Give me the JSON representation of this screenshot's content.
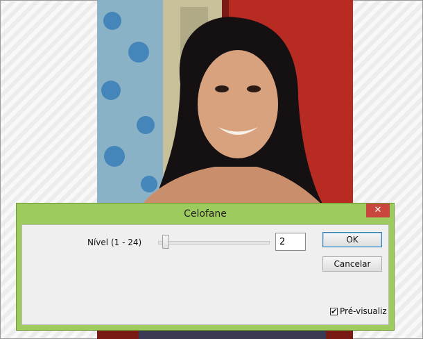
{
  "dialog": {
    "title": "Celofane",
    "close_glyph": "✕",
    "level": {
      "label": "Nível (1 - 24)",
      "value": "2",
      "min": 1,
      "max": 24,
      "slider_fraction": 0.04
    },
    "ok_label": "OK",
    "cancel_label": "Cancelar",
    "preview": {
      "label": "Pré-visualiz",
      "checked": true,
      "check_glyph": "✔"
    }
  },
  "colors": {
    "frame": "#9ecb5d",
    "close": "#c9463d",
    "client": "#efefef"
  }
}
